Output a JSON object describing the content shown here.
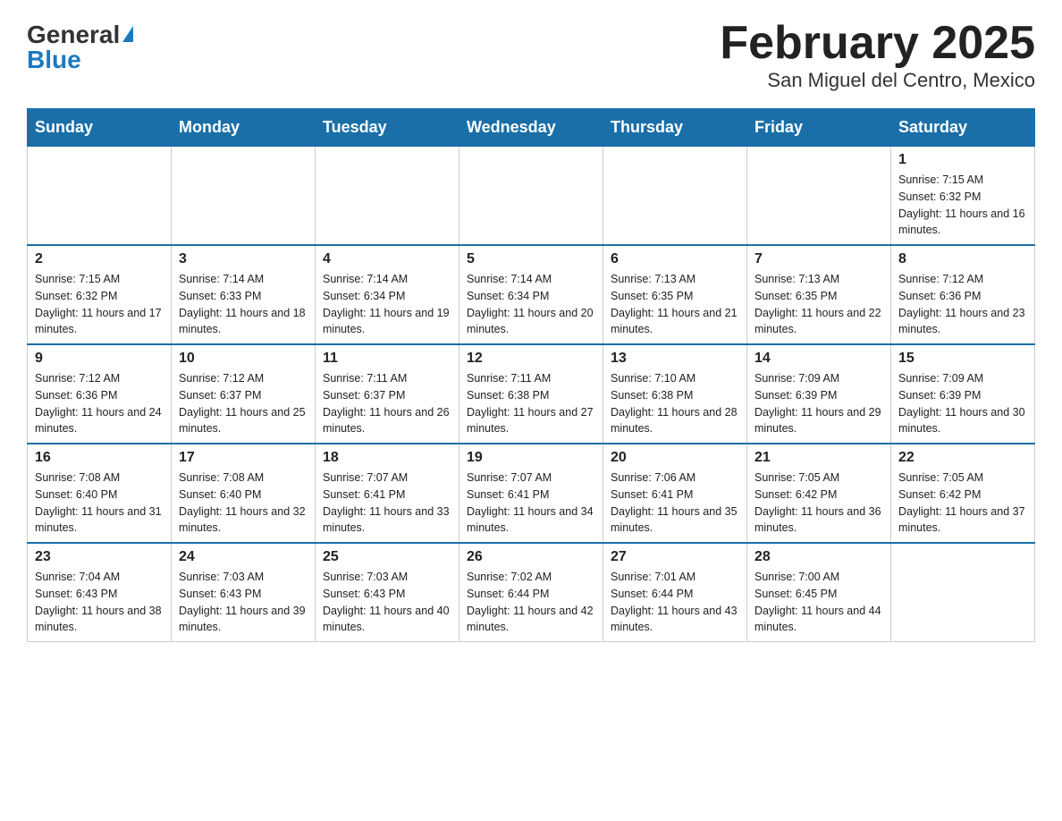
{
  "header": {
    "logo_general": "General",
    "logo_blue": "Blue",
    "month_title": "February 2025",
    "location": "San Miguel del Centro, Mexico"
  },
  "weekdays": [
    "Sunday",
    "Monday",
    "Tuesday",
    "Wednesday",
    "Thursday",
    "Friday",
    "Saturday"
  ],
  "weeks": [
    [
      {
        "day": "",
        "info": ""
      },
      {
        "day": "",
        "info": ""
      },
      {
        "day": "",
        "info": ""
      },
      {
        "day": "",
        "info": ""
      },
      {
        "day": "",
        "info": ""
      },
      {
        "day": "",
        "info": ""
      },
      {
        "day": "1",
        "info": "Sunrise: 7:15 AM\nSunset: 6:32 PM\nDaylight: 11 hours and 16 minutes."
      }
    ],
    [
      {
        "day": "2",
        "info": "Sunrise: 7:15 AM\nSunset: 6:32 PM\nDaylight: 11 hours and 17 minutes."
      },
      {
        "day": "3",
        "info": "Sunrise: 7:14 AM\nSunset: 6:33 PM\nDaylight: 11 hours and 18 minutes."
      },
      {
        "day": "4",
        "info": "Sunrise: 7:14 AM\nSunset: 6:34 PM\nDaylight: 11 hours and 19 minutes."
      },
      {
        "day": "5",
        "info": "Sunrise: 7:14 AM\nSunset: 6:34 PM\nDaylight: 11 hours and 20 minutes."
      },
      {
        "day": "6",
        "info": "Sunrise: 7:13 AM\nSunset: 6:35 PM\nDaylight: 11 hours and 21 minutes."
      },
      {
        "day": "7",
        "info": "Sunrise: 7:13 AM\nSunset: 6:35 PM\nDaylight: 11 hours and 22 minutes."
      },
      {
        "day": "8",
        "info": "Sunrise: 7:12 AM\nSunset: 6:36 PM\nDaylight: 11 hours and 23 minutes."
      }
    ],
    [
      {
        "day": "9",
        "info": "Sunrise: 7:12 AM\nSunset: 6:36 PM\nDaylight: 11 hours and 24 minutes."
      },
      {
        "day": "10",
        "info": "Sunrise: 7:12 AM\nSunset: 6:37 PM\nDaylight: 11 hours and 25 minutes."
      },
      {
        "day": "11",
        "info": "Sunrise: 7:11 AM\nSunset: 6:37 PM\nDaylight: 11 hours and 26 minutes."
      },
      {
        "day": "12",
        "info": "Sunrise: 7:11 AM\nSunset: 6:38 PM\nDaylight: 11 hours and 27 minutes."
      },
      {
        "day": "13",
        "info": "Sunrise: 7:10 AM\nSunset: 6:38 PM\nDaylight: 11 hours and 28 minutes."
      },
      {
        "day": "14",
        "info": "Sunrise: 7:09 AM\nSunset: 6:39 PM\nDaylight: 11 hours and 29 minutes."
      },
      {
        "day": "15",
        "info": "Sunrise: 7:09 AM\nSunset: 6:39 PM\nDaylight: 11 hours and 30 minutes."
      }
    ],
    [
      {
        "day": "16",
        "info": "Sunrise: 7:08 AM\nSunset: 6:40 PM\nDaylight: 11 hours and 31 minutes."
      },
      {
        "day": "17",
        "info": "Sunrise: 7:08 AM\nSunset: 6:40 PM\nDaylight: 11 hours and 32 minutes."
      },
      {
        "day": "18",
        "info": "Sunrise: 7:07 AM\nSunset: 6:41 PM\nDaylight: 11 hours and 33 minutes."
      },
      {
        "day": "19",
        "info": "Sunrise: 7:07 AM\nSunset: 6:41 PM\nDaylight: 11 hours and 34 minutes."
      },
      {
        "day": "20",
        "info": "Sunrise: 7:06 AM\nSunset: 6:41 PM\nDaylight: 11 hours and 35 minutes."
      },
      {
        "day": "21",
        "info": "Sunrise: 7:05 AM\nSunset: 6:42 PM\nDaylight: 11 hours and 36 minutes."
      },
      {
        "day": "22",
        "info": "Sunrise: 7:05 AM\nSunset: 6:42 PM\nDaylight: 11 hours and 37 minutes."
      }
    ],
    [
      {
        "day": "23",
        "info": "Sunrise: 7:04 AM\nSunset: 6:43 PM\nDaylight: 11 hours and 38 minutes."
      },
      {
        "day": "24",
        "info": "Sunrise: 7:03 AM\nSunset: 6:43 PM\nDaylight: 11 hours and 39 minutes."
      },
      {
        "day": "25",
        "info": "Sunrise: 7:03 AM\nSunset: 6:43 PM\nDaylight: 11 hours and 40 minutes."
      },
      {
        "day": "26",
        "info": "Sunrise: 7:02 AM\nSunset: 6:44 PM\nDaylight: 11 hours and 42 minutes."
      },
      {
        "day": "27",
        "info": "Sunrise: 7:01 AM\nSunset: 6:44 PM\nDaylight: 11 hours and 43 minutes."
      },
      {
        "day": "28",
        "info": "Sunrise: 7:00 AM\nSunset: 6:45 PM\nDaylight: 11 hours and 44 minutes."
      },
      {
        "day": "",
        "info": ""
      }
    ]
  ]
}
